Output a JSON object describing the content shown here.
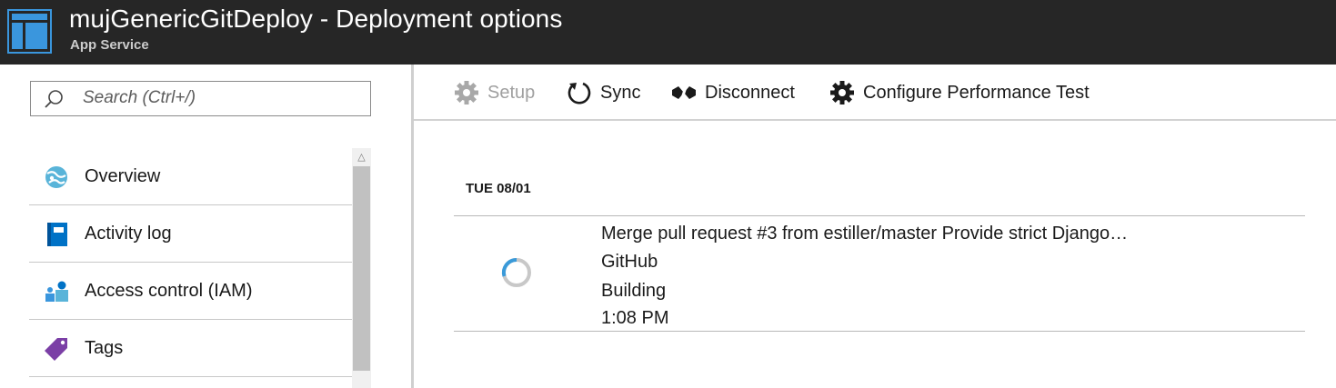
{
  "header": {
    "title": "mujGenericGitDeploy - Deployment options",
    "subtitle": "App Service",
    "icon": "app-service-icon"
  },
  "search": {
    "placeholder": "Search (Ctrl+/)"
  },
  "sidebar": {
    "items": [
      {
        "label": "Overview",
        "icon": "overview-globe-icon"
      },
      {
        "label": "Activity log",
        "icon": "activity-log-icon"
      },
      {
        "label": "Access control (IAM)",
        "icon": "access-control-icon"
      },
      {
        "label": "Tags",
        "icon": "tag-icon"
      }
    ]
  },
  "toolbar": {
    "setup_label": "Setup",
    "sync_label": "Sync",
    "disconnect_label": "Disconnect",
    "perf_test_label": "Configure Performance Test"
  },
  "deployments": {
    "date": "TUE 08/01",
    "items": [
      {
        "message": "Merge pull request #3 from estiller/master Provide strict Django…",
        "source": "GitHub",
        "status": "Building",
        "time": "1:08 PM"
      }
    ]
  },
  "colors": {
    "header_bg": "#262626",
    "accent_blue": "#0072c6",
    "tag_purple": "#7b3fa6",
    "spinner_blue": "#3a9ad9"
  }
}
